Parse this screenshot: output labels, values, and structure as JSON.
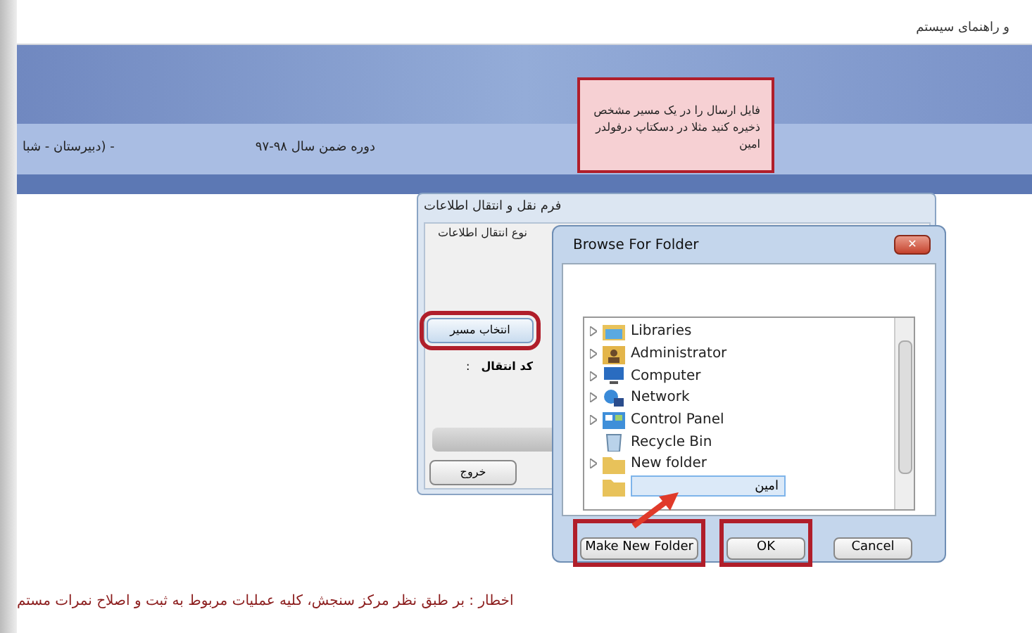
{
  "header": {
    "help_link": "و راهنمای سیستم"
  },
  "callout": {
    "text": "فایل ارسال را در یک مسیر مشخص ذخیره کنید مثلا در دسکتاپ درفولدر امین"
  },
  "info_bar": {
    "school": "- (دبیرستان - شبا",
    "course": "دوره ضمن سال ۹۸-۹۷"
  },
  "transfer_dialog": {
    "title": "فرم نقل و انتقال اطلاعات",
    "group_label": "نوع انتقال اطلاعات",
    "choose_path_button": {
      "label": "انتخاب مسیر",
      "highlighted": true
    },
    "code_label": "کد انتقال",
    "colon": ":",
    "exit_button": "خروج"
  },
  "browse_dialog": {
    "title": "Browse For Folder",
    "close": "✕",
    "tree": [
      {
        "kind": "library",
        "label": "Libraries",
        "expandable": true
      },
      {
        "kind": "user",
        "label": "Administrator",
        "expandable": true
      },
      {
        "kind": "computer",
        "label": "Computer",
        "expandable": true
      },
      {
        "kind": "network",
        "label": "Network",
        "expandable": true
      },
      {
        "kind": "control-panel",
        "label": "Control Panel",
        "expandable": true
      },
      {
        "kind": "recycle-bin",
        "label": "Recycle Bin",
        "expandable": false
      },
      {
        "kind": "folder",
        "label": "New folder",
        "expandable": true
      },
      {
        "kind": "rename",
        "value": "امین",
        "expandable": false
      }
    ],
    "make_new_folder_button": {
      "label": "Make New Folder",
      "highlighted": true
    },
    "ok_button": {
      "label": "OK",
      "highlighted": true
    },
    "cancel_button": {
      "label": "Cancel",
      "highlighted": false
    }
  },
  "warning": {
    "text": "اخطار : بر طبق نظر مرکز سنجش، کلیه عملیات مربوط به ثبت و اصلاح نمرات مستم"
  }
}
